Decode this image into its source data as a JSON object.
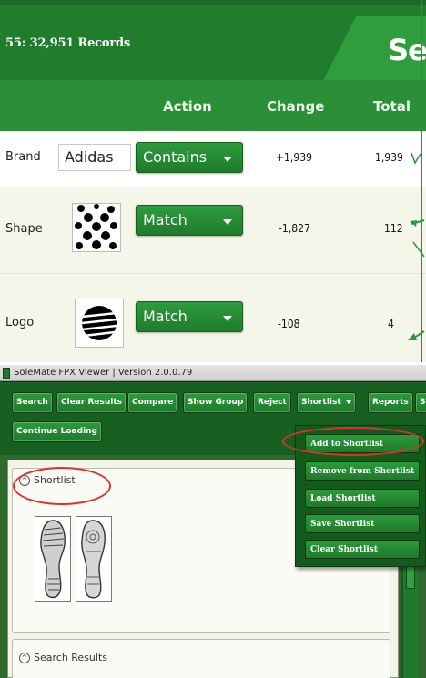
{
  "top_panel": {
    "records_label": "55: 32,951 Records",
    "search_tab": "Sea",
    "columns": {
      "action": "Action",
      "change": "Change",
      "total": "Total"
    },
    "rows": [
      {
        "label": "Brand",
        "input_value": "Adidas",
        "action": "Contains",
        "change": "+1,939",
        "total": "1,939"
      },
      {
        "label": "Shape",
        "action": "Match",
        "change": "-1,827",
        "total": "112"
      },
      {
        "label": "Logo",
        "action": "Match",
        "change": "-108",
        "total": "4"
      }
    ]
  },
  "viewer": {
    "title": "SoleMate FPX Viewer | Version 2.0.0.79",
    "toolbar": [
      {
        "label": "Search"
      },
      {
        "label": "Clear Results"
      },
      {
        "label": "Compare"
      },
      {
        "label": "Show Group"
      },
      {
        "label": "Reject"
      },
      {
        "label": "Shortlist",
        "dropdown": true
      },
      {
        "label": "Reports"
      },
      {
        "label": "S"
      }
    ],
    "continue_label": "Continue Loading",
    "shortlist_menu": [
      "Add to Shortlist",
      "Remove from Shortlist",
      "Load Shortlist",
      "Save Shortlist",
      "Clear Shortlist"
    ],
    "sections": {
      "shortlist": "Shortlist",
      "search_results": "Search Results"
    }
  },
  "colors": {
    "brand_green": "#217d2e",
    "toolbar_green": "#185f22",
    "annotation_red": "#d9342b",
    "arrow_green": "#2a9a3a"
  }
}
